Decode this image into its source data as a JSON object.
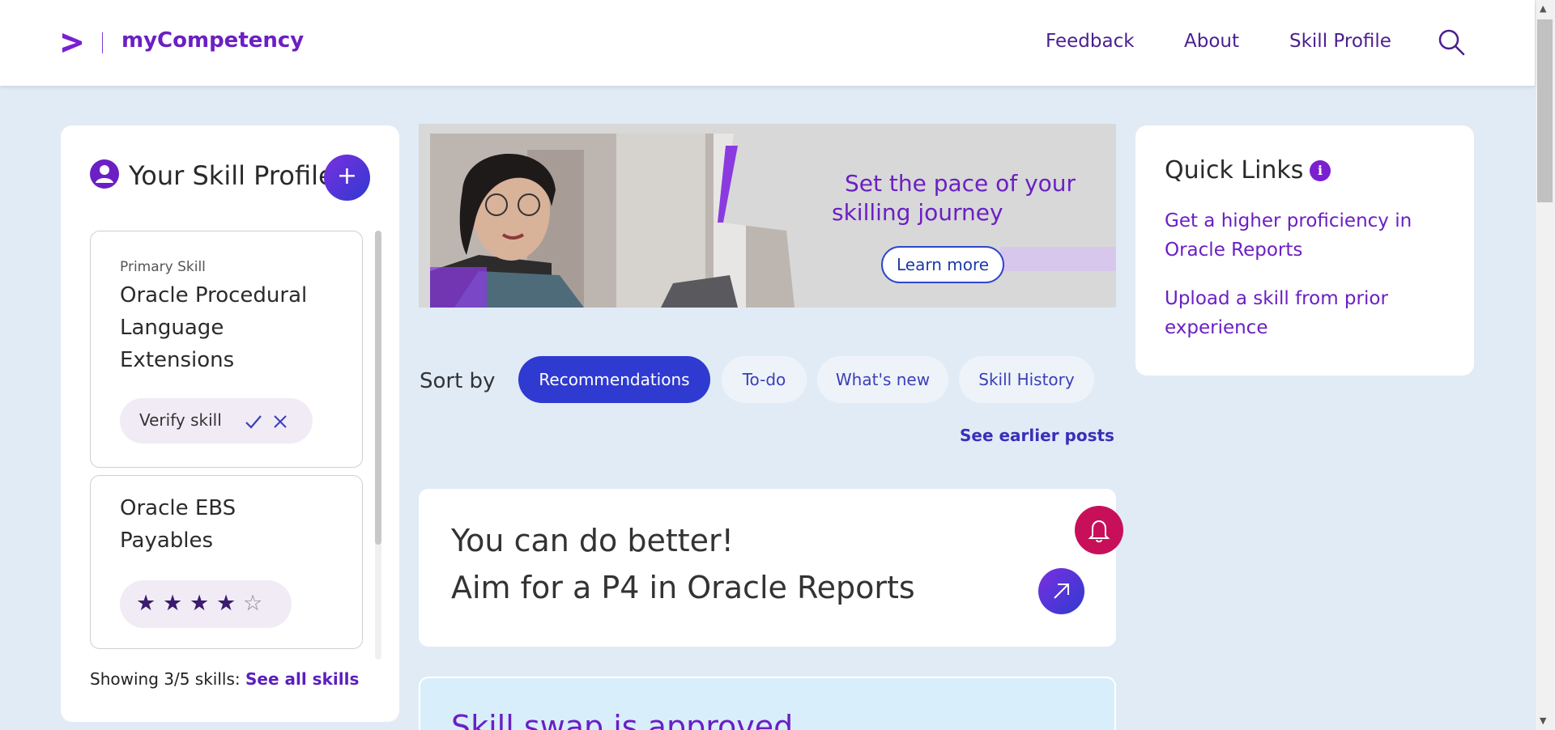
{
  "header": {
    "brand": "myCompetency",
    "nav": {
      "feedback": "Feedback",
      "about": "About",
      "skill_profile": "Skill Profile"
    }
  },
  "profile": {
    "title": "Your Skill Profile",
    "add_label": "+",
    "skills": [
      {
        "primary_label": "Primary Skill",
        "name_lines": [
          "Oracle Procedural",
          "Language",
          "Extensions"
        ],
        "verify_label": "Verify skill"
      },
      {
        "name_lines": [
          "Oracle EBS",
          "Payables"
        ],
        "rating": 4,
        "max_rating": 5,
        "star_full": "★",
        "star_empty": "☆"
      }
    ],
    "showing": "Showing 3/5 skills:",
    "see_all": "See all skills"
  },
  "banner": {
    "line1": "Set the pace of your",
    "line2": "skilling journey",
    "cta": "Learn more"
  },
  "feed": {
    "sort_label": "Sort by",
    "chips": [
      "Recommendations",
      "To-do",
      "What's new",
      "Skill History"
    ],
    "active_chip": "Recommendations",
    "see_earlier": "See earlier posts",
    "card": {
      "line1": "You can do better!",
      "line2": "Aim for a P4 in Oracle Reports"
    },
    "swap_title": "Skill swap is approved"
  },
  "quick_links": {
    "title": "Quick Links",
    "info": "i",
    "links": [
      {
        "lines": [
          "Get a higher proficiency in",
          "Oracle Reports"
        ]
      },
      {
        "lines": [
          "Upload a skill from prior",
          "experience"
        ]
      }
    ]
  },
  "colors": {
    "accent": "#6b1fc4",
    "primary_button": "#2f3ad0",
    "alert": "#c8105a",
    "background": "#e0ebf6"
  },
  "icons": [
    "accenture-chevron-icon",
    "search-icon",
    "user-circle-icon",
    "plus-icon",
    "check-icon",
    "close-icon",
    "bell-icon",
    "arrow-up-right-icon",
    "info-icon"
  ]
}
